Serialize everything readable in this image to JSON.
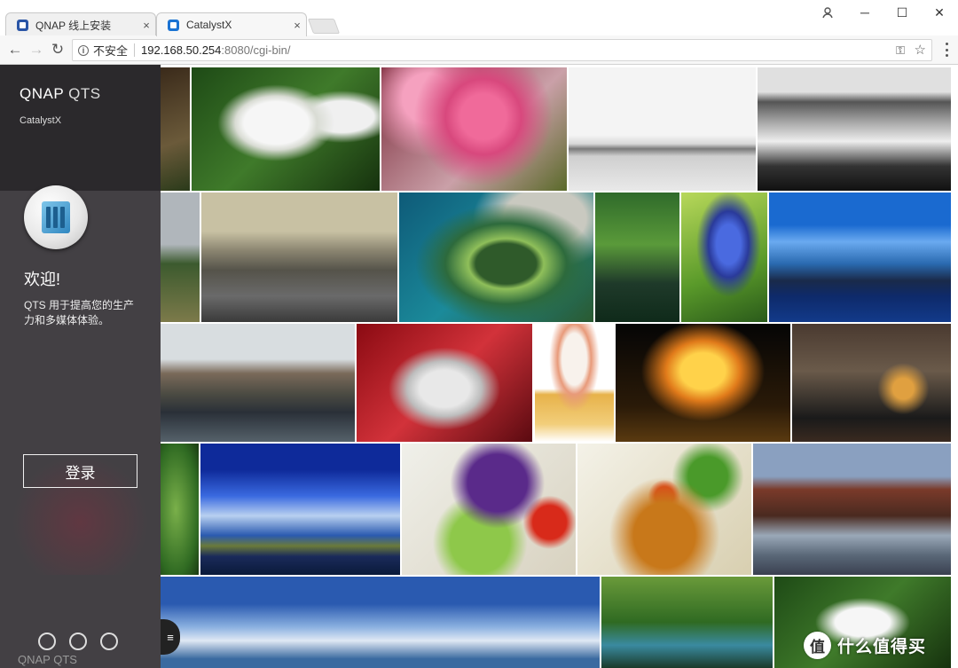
{
  "browser": {
    "tabs": [
      {
        "title": "QNAP 线上安装",
        "close": "×",
        "active": false
      },
      {
        "title": "CatalystX",
        "close": "×",
        "active": true
      }
    ],
    "window_controls": {
      "minimize": "─",
      "maximize": "☐",
      "close": "✕"
    },
    "nav": {
      "back": "←",
      "forward": "→",
      "reload": "↻"
    },
    "address": {
      "security_label": "不安全",
      "host": "192.168.50.254",
      "path": ":8080/cgi-bin/"
    }
  },
  "login_panel": {
    "brand_primary": "QNAP",
    "brand_secondary": "QTS",
    "device_name": "CatalystX",
    "welcome": "欢迎!",
    "description": "QTS 用于提高您的生产力和多媒体体验。",
    "login_button": "登录",
    "footer_logo": "QNAP QTS",
    "footer_icons": [
      "qmanager-icon",
      "qfinder-icon",
      "qfile-icon"
    ]
  },
  "watermark": {
    "badge": "值",
    "text": "什么值得买"
  },
  "accent_colors": {
    "active_tab_icon": "#1b73d3",
    "sidebar_bg": "#0e0a10"
  }
}
